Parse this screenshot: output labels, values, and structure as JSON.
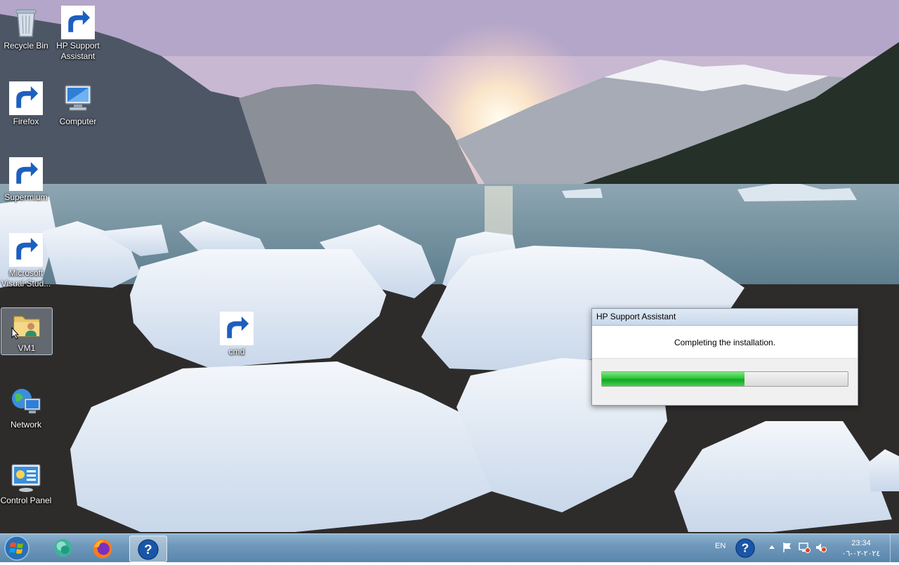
{
  "desktop": {
    "icons": [
      {
        "label": "Recycle Bin",
        "icon": "recycle-bin-icon"
      },
      {
        "label": "HP Support Assistant",
        "icon": "hp-support-assistant-icon"
      },
      {
        "label": "Firefox",
        "icon": "firefox-icon"
      },
      {
        "label": "Computer",
        "icon": "computer-icon"
      },
      {
        "label": "Supermium",
        "icon": "supermium-icon"
      },
      {
        "label": "Microsoft Visual Stud...",
        "icon": "visual-studio-icon"
      },
      {
        "label": "VM1",
        "icon": "user-folder-icon"
      },
      {
        "label": "cmd",
        "icon": "cmd-icon"
      },
      {
        "label": "Network",
        "icon": "network-icon"
      },
      {
        "label": "Control Panel",
        "icon": "control-panel-icon"
      }
    ]
  },
  "dialog": {
    "title": "HP Support Assistant",
    "message": "Completing the installation.",
    "progress": 0.58,
    "progress_color": "#1fba2e"
  },
  "taskbar": {
    "pinned": [
      {
        "name": "supermium",
        "icon": "supermium-icon"
      },
      {
        "name": "firefox",
        "icon": "firefox-icon"
      },
      {
        "name": "hp-support-assistant",
        "icon": "hp-support-assistant-icon",
        "active": true
      }
    ],
    "language": "EN",
    "time": "23:34",
    "date": "٢٠٢٤-٠٢-٠٦"
  }
}
